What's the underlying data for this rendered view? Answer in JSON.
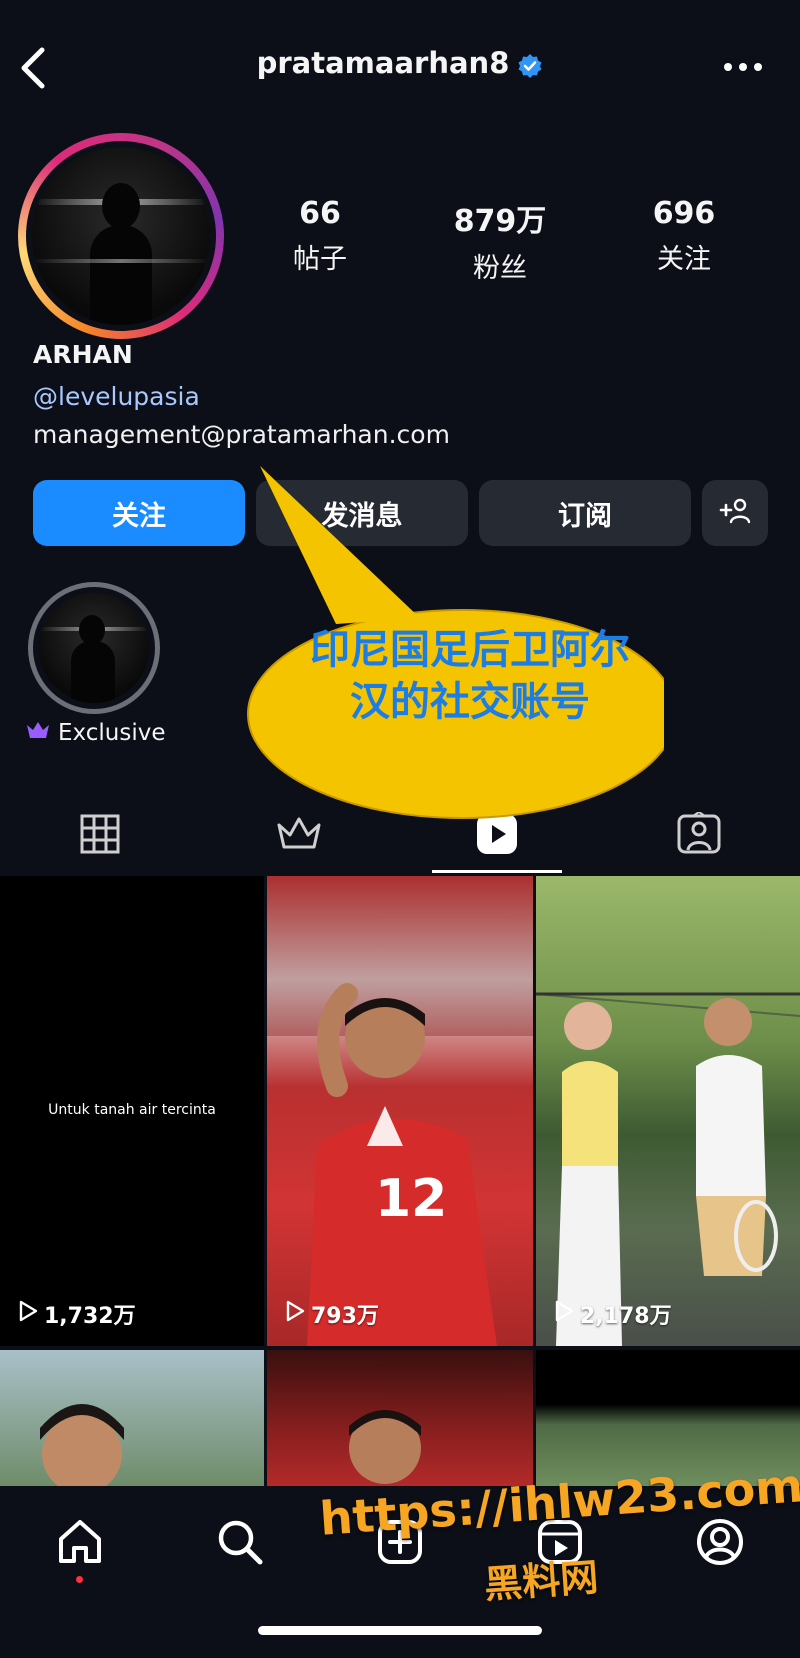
{
  "header": {
    "username": "pratamaarhan8",
    "icons": {
      "back": "chevron-left-icon",
      "verified": "verified-badge-icon",
      "more": "more-horizontal-icon"
    }
  },
  "profile": {
    "stats": [
      {
        "value": "66",
        "label": "帖子"
      },
      {
        "value": "879万",
        "label": "粉丝"
      },
      {
        "value": "696",
        "label": "关注"
      }
    ],
    "name": "ARHAN",
    "mention": "@levelupasia",
    "email": "management@pratamarhan.com"
  },
  "actions": {
    "follow": "关注",
    "message": "发消息",
    "subscribe": "订阅",
    "add_person_icon": "person-add-icon"
  },
  "highlight": {
    "label": "Exclusive",
    "icon": "crown-icon"
  },
  "tabs": [
    {
      "name": "grid",
      "icon": "grid-icon"
    },
    {
      "name": "exclusive",
      "icon": "crown-icon"
    },
    {
      "name": "reels",
      "icon": "reels-icon",
      "active": true
    },
    {
      "name": "tagged",
      "icon": "person-tag-icon"
    }
  ],
  "posts": [
    {
      "views": "1,732万",
      "caption": "Untuk tanah air tercinta"
    },
    {
      "views": "793万"
    },
    {
      "views": "2,178万"
    }
  ],
  "annotation": {
    "callout_text": "印尼国足后卫阿尔汉的社交账号",
    "callout_color": "#f5c400"
  },
  "watermark": {
    "url": "https://ihlw23.com",
    "sub": "黑料网",
    "color": "#f7a623"
  },
  "bottom_nav": [
    {
      "name": "home",
      "icon": "home-icon",
      "active": true
    },
    {
      "name": "search",
      "icon": "search-icon"
    },
    {
      "name": "create",
      "icon": "plus-square-icon"
    },
    {
      "name": "reels",
      "icon": "reels-icon"
    },
    {
      "name": "profile",
      "icon": "profile-icon"
    }
  ]
}
